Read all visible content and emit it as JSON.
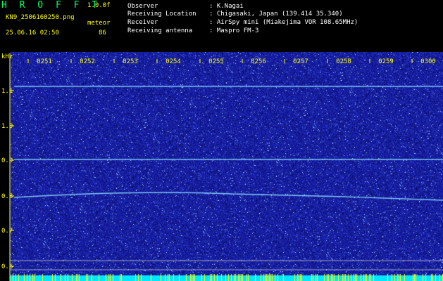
{
  "header": {
    "app_name": "H R O F F T",
    "version": "1.0.0f",
    "filename": "KN9_2506160250.png",
    "mode_label": "meteor",
    "datetime": "25.06.16 02:50",
    "count": "86",
    "info_labels": [
      "Observer",
      "Receiving Location",
      "Receiver",
      "Receiving antenna"
    ],
    "info_values": [
      ": K.Nagai",
      ": Chigasaki, Japan (139.414 35.340)",
      ": AirSpy mini (Miakejima VOR 108.65MHz)",
      ": Maspro FM-3"
    ]
  },
  "spectrogram": {
    "y_unit": "kHz",
    "y_ticks": [
      "1.1",
      "1.0",
      "0.9",
      "0.8",
      "0.7",
      "0.6"
    ],
    "time_labels": [
      "0251",
      "0252",
      "0253",
      "0254",
      "0255",
      "0256",
      "0257",
      "0258",
      "0259",
      "0300"
    ]
  },
  "colors": {
    "background": "#000000",
    "noise_base": "#1f26a8",
    "signal": "#7fe0ff",
    "title": "#00ff66",
    "axis": "#ffff00",
    "meteor_bar": "#00ffff"
  }
}
